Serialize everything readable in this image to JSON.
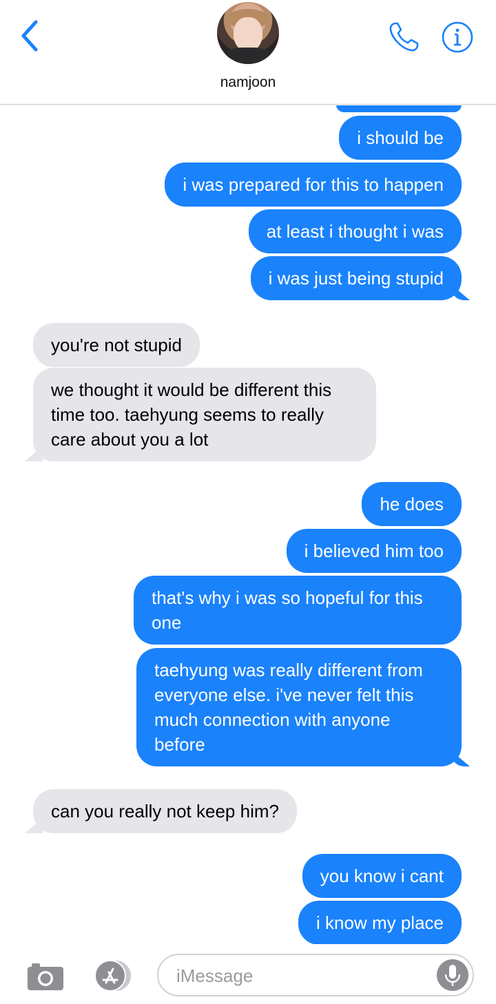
{
  "header": {
    "contact_name": "namjoon",
    "icons": {
      "back": "chevron-left-icon",
      "phone": "phone-icon",
      "info": "info-icon"
    },
    "accent_color": "#1a82fb"
  },
  "messages": [
    {
      "from": "me",
      "text": "i should be"
    },
    {
      "from": "me",
      "text": "i was prepared for this to happen"
    },
    {
      "from": "me",
      "text": "at least i thought i was"
    },
    {
      "from": "me",
      "text": "i was just being stupid"
    },
    {
      "from": "them",
      "text": "you're not stupid"
    },
    {
      "from": "them",
      "text": "we thought it would be different this time too. taehyung seems to really care about you a lot"
    },
    {
      "from": "me",
      "text": "he does"
    },
    {
      "from": "me",
      "text": "i believed him too"
    },
    {
      "from": "me",
      "text": "that's why i was so hopeful for this one"
    },
    {
      "from": "me",
      "text": "taehyung was really different from everyone else. i've never felt this much connection with anyone before"
    },
    {
      "from": "them",
      "text": "can you really not keep him?"
    },
    {
      "from": "me",
      "text": "you know i cant"
    },
    {
      "from": "me",
      "text": "i know my place"
    }
  ],
  "composer": {
    "placeholder": "iMessage",
    "icons": {
      "camera": "camera-icon",
      "apps": "app-store-icon",
      "mic": "microphone-icon"
    }
  },
  "colors": {
    "sent_bubble": "#1a82fb",
    "received_bubble": "#e5e5ea"
  }
}
